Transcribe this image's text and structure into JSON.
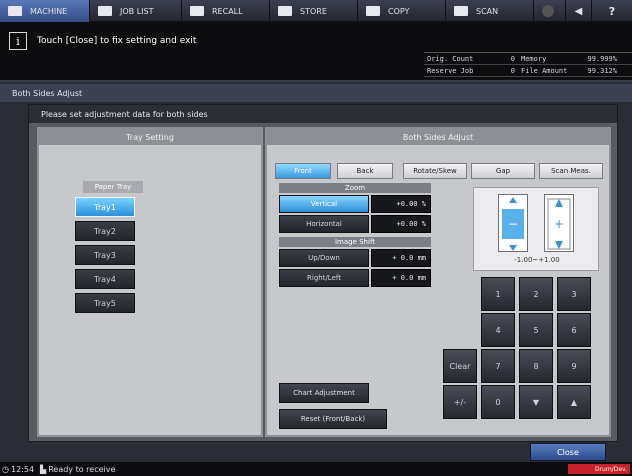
{
  "top_tabs": [
    {
      "label": "MACHINE",
      "icon": "machine-icon"
    },
    {
      "label": "JOB LIST",
      "icon": "job-list-icon"
    },
    {
      "label": "RECALL",
      "icon": "recall-icon"
    },
    {
      "label": "STORE",
      "icon": "store-icon"
    },
    {
      "label": "COPY",
      "icon": "copy-icon"
    },
    {
      "label": "SCAN",
      "icon": "scan-icon"
    }
  ],
  "message": {
    "text": "Touch [Close] to fix setting and exit"
  },
  "counts": {
    "orig_count_label": "Orig. Count",
    "orig_count_value": "0",
    "memory_label": "Memory",
    "memory_value": "99.999%",
    "reserve_job_label": "Reserve Job",
    "reserve_job_value": "0",
    "file_amount_label": "File Amount",
    "file_amount_value": "99.312%"
  },
  "screen_title": "Both Sides Adjust",
  "instruction": "Please set adjustment data for both sides",
  "left_panel": {
    "title": "Tray Setting",
    "caption": "Paper Tray",
    "trays": [
      "Tray1",
      "Tray2",
      "Tray3",
      "Tray4",
      "Tray5"
    ],
    "selected": "Tray1"
  },
  "right_panel": {
    "title": "Both Sides Adjust",
    "tabs": [
      "Front",
      "Back",
      "Rotate/Skew",
      "Gap",
      "Scan Meas."
    ],
    "active_tab": "Front",
    "zoom_label": "Zoom",
    "vertical_label": "Vertical",
    "vertical_value": "+0.00 %",
    "horizontal_label": "Horizontal",
    "horizontal_value": "+0.00 %",
    "shift_label": "Image Shift",
    "updown_label": "Up/Down",
    "updown_value": "+ 0.0 mm",
    "rightleft_label": "Right/Left",
    "rightleft_value": "+ 0.0 mm",
    "range_text": "-1.00~+1.00",
    "chart_btn": "Chart Adjustment",
    "reset_btn": "Reset (Front/Back)"
  },
  "keypad": {
    "keys": [
      "1",
      "2",
      "3",
      "4",
      "5",
      "6",
      "Clear",
      "7",
      "8",
      "9",
      "+/-",
      "0",
      "▼",
      "▲"
    ]
  },
  "close_label": "Close",
  "status": {
    "time": "12:54",
    "text": "Ready to receive",
    "badge": "Drum/Dev."
  }
}
